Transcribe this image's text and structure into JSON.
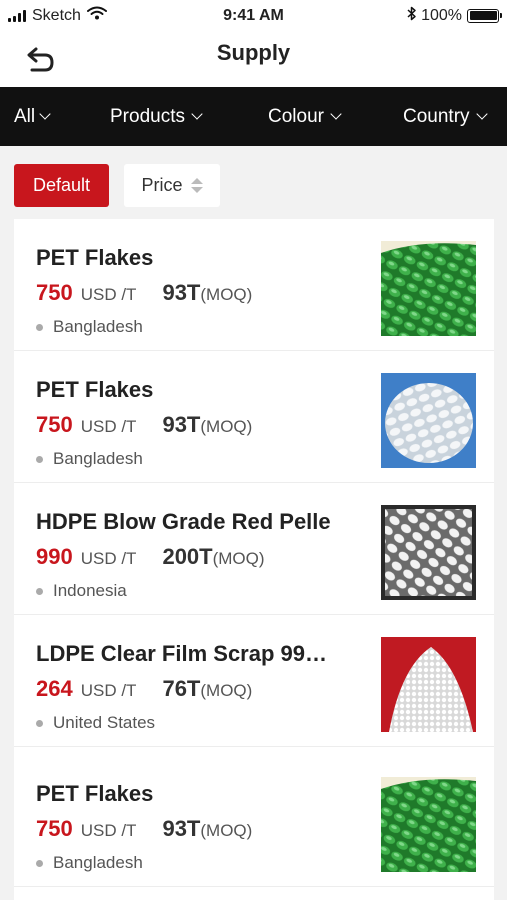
{
  "status_bar": {
    "carrier": "Sketch",
    "time": "9:41 AM",
    "battery": "100%",
    "battery_level": 1.0
  },
  "nav": {
    "title": "Supply"
  },
  "filters": [
    {
      "label": "All"
    },
    {
      "label": "Products"
    },
    {
      "label": "Colour"
    },
    {
      "label": "Country"
    }
  ],
  "sort": {
    "default_label": "Default",
    "price_label": "Price"
  },
  "colors": {
    "accent": "#c8161d",
    "filter_bar": "#111111"
  },
  "products": [
    {
      "title": "PET Flakes",
      "price": "750",
      "unit": "USD /T",
      "moq": "93T",
      "moq_label": "(MOQ)",
      "country": "Bangladesh",
      "image": "green-pellets"
    },
    {
      "title": "PET Flakes",
      "price": "750",
      "unit": "USD /T",
      "moq": "93T",
      "moq_label": "(MOQ)",
      "country": "Bangladesh",
      "image": "white-pellets-blue-bg"
    },
    {
      "title": "HDPE Blow Grade Red Pelle",
      "price": "990",
      "unit": "USD /T",
      "moq": "200T",
      "moq_label": "(MOQ)",
      "country": "Indonesia",
      "image": "white-pellets-dark-bg"
    },
    {
      "title": "LDPE Clear Film Scrap 99…",
      "price": "264",
      "unit": "USD /T",
      "moq": "76T",
      "moq_label": "(MOQ)",
      "country": "United States",
      "image": "white-granules-red-bg"
    },
    {
      "title": "PET Flakes",
      "price": "750",
      "unit": "USD /T",
      "moq": "93T",
      "moq_label": "(MOQ)",
      "country": "Bangladesh",
      "image": "green-pellets"
    }
  ]
}
